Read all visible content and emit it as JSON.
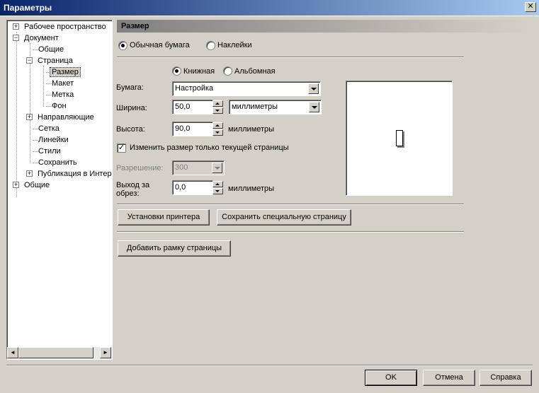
{
  "window": {
    "title": "Параметры",
    "close_glyph": "✕"
  },
  "tree": {
    "items": [
      {
        "label": "Рабочее пространство",
        "expander": "+"
      },
      {
        "label": "Документ",
        "expander": "−"
      },
      {
        "label": "Общие"
      },
      {
        "label": "Страница",
        "expander": "−"
      },
      {
        "label": "Размер"
      },
      {
        "label": "Макет"
      },
      {
        "label": "Метка"
      },
      {
        "label": "Фон"
      },
      {
        "label": "Направляющие",
        "expander": "+"
      },
      {
        "label": "Сетка"
      },
      {
        "label": "Линейки"
      },
      {
        "label": "Стили"
      },
      {
        "label": "Сохранить"
      },
      {
        "label": "Публикация в Интер",
        "expander": "+"
      },
      {
        "label": "Общие",
        "expander": "+"
      }
    ],
    "selected": "Размер"
  },
  "page": {
    "header": "Размер",
    "label_type": {
      "normal": "Обычная бумага",
      "labels": "Наклейки",
      "selected": "normal"
    },
    "orientation": {
      "portrait": "Книжная",
      "landscape": "Альбомная",
      "selected": "portrait"
    },
    "paper": {
      "label": "Бумага:",
      "value": "Настройка"
    },
    "width": {
      "label": "Ширина:",
      "value": "50,0",
      "units": "миллиметры"
    },
    "height": {
      "label": "Высота:",
      "value": "90,0",
      "units": "миллиметры"
    },
    "resize_current_only": {
      "label": "Изменить размер только текущей страницы",
      "checked": true
    },
    "resolution": {
      "label": "Разрешение:",
      "value": "300"
    },
    "bleed": {
      "label_line1": "Выход за",
      "label_line2": "обрез:",
      "value": "0,0",
      "units": "миллиметры"
    },
    "buttons": {
      "printer_settings": "Установки принтера",
      "save_custom_page": "Сохранить специальную страницу",
      "add_page_frame": "Добавить рамку страницы"
    }
  },
  "footer": {
    "ok": "OK",
    "cancel": "Отмена",
    "help": "Справка"
  },
  "scroll": {
    "left_glyph": "◄",
    "right_glyph": "►"
  }
}
